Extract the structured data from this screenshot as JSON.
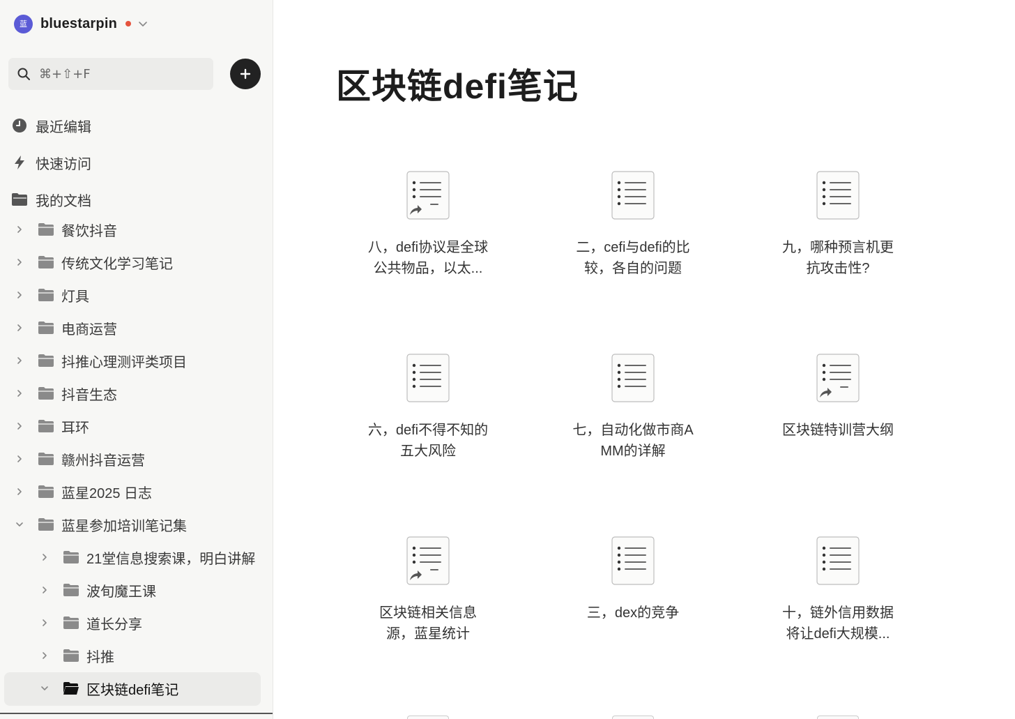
{
  "account": {
    "avatar_text": "蓝",
    "name": "bluestarpin"
  },
  "search": {
    "placeholder": "⌘+⇧+F"
  },
  "nav": [
    {
      "label": "最近编辑",
      "icon": "clock-icon"
    },
    {
      "label": "快速访问",
      "icon": "lightning-icon"
    },
    {
      "label": "我的文档",
      "icon": "folder-open-icon"
    }
  ],
  "tree": [
    {
      "label": "餐饮抖音",
      "depth": 0,
      "expanded": false
    },
    {
      "label": "传统文化学习笔记",
      "depth": 0,
      "expanded": false
    },
    {
      "label": "灯具",
      "depth": 0,
      "expanded": false
    },
    {
      "label": "电商运营",
      "depth": 0,
      "expanded": false
    },
    {
      "label": "抖推心理测评类项目",
      "depth": 0,
      "expanded": false
    },
    {
      "label": "抖音生态",
      "depth": 0,
      "expanded": false
    },
    {
      "label": "耳环",
      "depth": 0,
      "expanded": false
    },
    {
      "label": "赣州抖音运营",
      "depth": 0,
      "expanded": false
    },
    {
      "label": "蓝星2025 日志",
      "depth": 0,
      "expanded": false
    },
    {
      "label": "蓝星参加培训笔记集",
      "depth": 0,
      "expanded": true
    },
    {
      "label": "21堂信息搜索课，明白讲解",
      "depth": 1,
      "expanded": false
    },
    {
      "label": "波旬魔王课",
      "depth": 1,
      "expanded": false
    },
    {
      "label": "道长分享",
      "depth": 1,
      "expanded": false
    },
    {
      "label": "抖推",
      "depth": 1,
      "expanded": false
    },
    {
      "label": "区块链defi笔记",
      "depth": 1,
      "expanded": true,
      "selected": true
    }
  ],
  "main": {
    "title": "区块链defi笔记",
    "docs": [
      {
        "line1": "八，defi协议是全球",
        "line2": "公共物品，以太...",
        "shared": true
      },
      {
        "line1": "二，cefi与defi的比",
        "line2": "较，各自的问题",
        "shared": false
      },
      {
        "line1": "九，哪种预言机更",
        "line2": "抗攻击性?",
        "shared": false
      },
      {
        "line1": "六，defi不得不知的",
        "line2": "五大风险",
        "shared": false
      },
      {
        "line1": "七，自动化做市商A",
        "line2": "MM的详解",
        "shared": false
      },
      {
        "line1": "区块链特训营大纲",
        "line2": "",
        "shared": true
      },
      {
        "line1": "区块链相关信息",
        "line2": "源，蓝星统计",
        "shared": true
      },
      {
        "line1": "三，dex的竞争",
        "line2": "",
        "shared": false
      },
      {
        "line1": "十，链外信用数据",
        "line2": "将让defi大规模...",
        "shared": false
      }
    ]
  },
  "colors": {
    "avatar": "#5b5bd6",
    "status_dot": "#e5533d",
    "add_button": "#222222"
  }
}
